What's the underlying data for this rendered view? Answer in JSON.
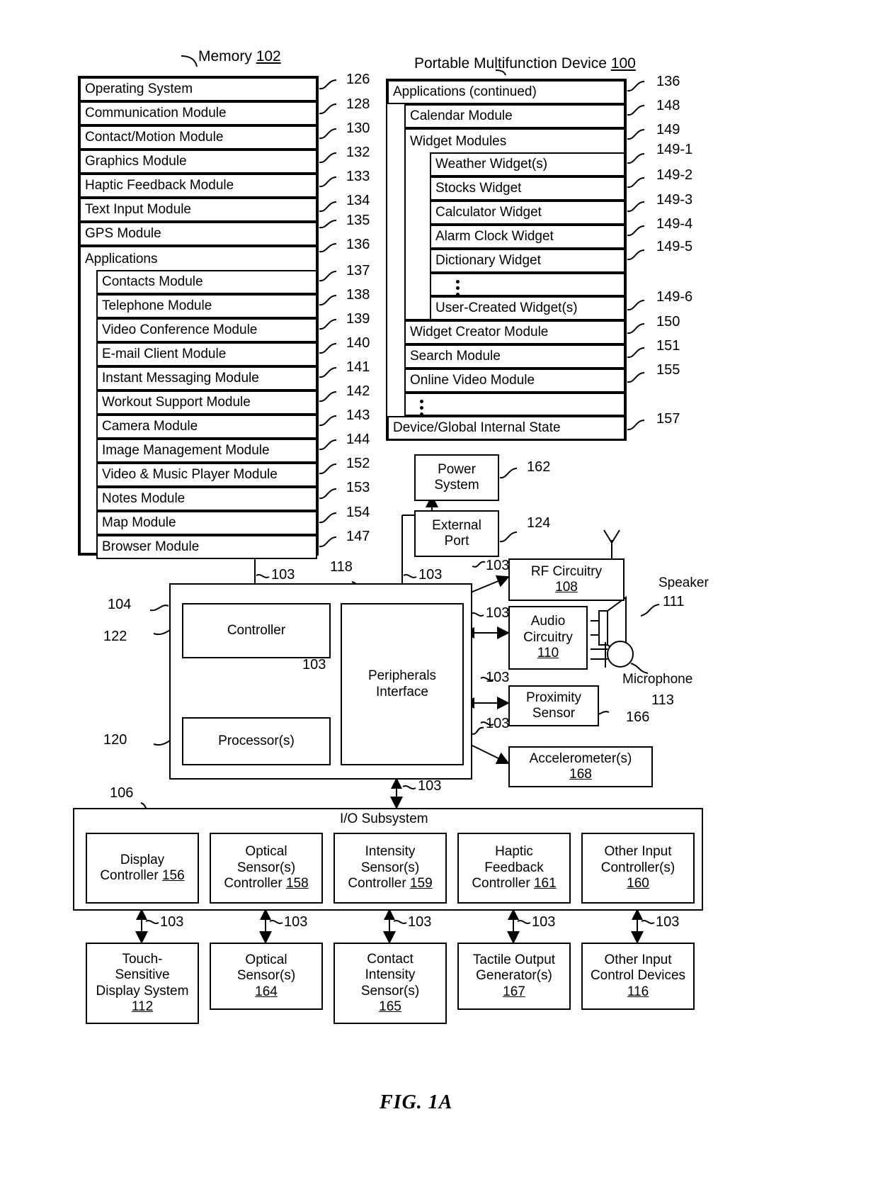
{
  "figure": {
    "caption": "FIG. 1A"
  },
  "memory": {
    "title": "Memory",
    "title_ref": "102",
    "rows": [
      {
        "label": "Operating System",
        "ref": "126"
      },
      {
        "label": "Communication Module",
        "ref": "128"
      },
      {
        "label": "Contact/Motion Module",
        "ref": "130"
      },
      {
        "label": "Graphics Module",
        "ref": "132"
      },
      {
        "label": "Haptic Feedback Module",
        "ref": "133"
      },
      {
        "label": "Text Input Module",
        "ref": "134"
      },
      {
        "label": "GPS Module",
        "ref": "135"
      },
      {
        "label": "Applications",
        "ref": "136"
      }
    ],
    "applications": [
      {
        "label": "Contacts Module",
        "ref": "137"
      },
      {
        "label": "Telephone Module",
        "ref": "138"
      },
      {
        "label": "Video Conference Module",
        "ref": "139"
      },
      {
        "label": "E-mail Client Module",
        "ref": "140"
      },
      {
        "label": "Instant Messaging Module",
        "ref": "141"
      },
      {
        "label": "Workout Support Module",
        "ref": "142"
      },
      {
        "label": "Camera Module",
        "ref": "143"
      },
      {
        "label": "Image Management Module",
        "ref": "144"
      },
      {
        "label": "Video & Music Player Module",
        "ref": "152"
      },
      {
        "label": "Notes Module",
        "ref": "153"
      },
      {
        "label": "Map Module",
        "ref": "154"
      },
      {
        "label": "Browser Module",
        "ref": "147"
      }
    ]
  },
  "device": {
    "title": "Portable Multifunction Device",
    "title_ref": "100",
    "applications_continued": {
      "label": "Applications (continued)",
      "ref": "136"
    },
    "calendar": {
      "label": "Calendar Module",
      "ref": "148"
    },
    "widget_modules": {
      "label": "Widget Modules",
      "ref": "149"
    },
    "widgets": [
      {
        "label": "Weather Widget(s)",
        "ref": "149-1"
      },
      {
        "label": "Stocks Widget",
        "ref": "149-2"
      },
      {
        "label": "Calculator Widget",
        "ref": "149-3"
      },
      {
        "label": "Alarm Clock Widget",
        "ref": "149-4"
      },
      {
        "label": "Dictionary Widget",
        "ref": "149-5"
      }
    ],
    "user_created": {
      "label": "User-Created Widget(s)",
      "ref": "149-6"
    },
    "tail_modules": [
      {
        "label": "Widget Creator Module",
        "ref": "150"
      },
      {
        "label": "Search Module",
        "ref": "151"
      },
      {
        "label": "Online Video Module",
        "ref": "155"
      }
    ],
    "global_state": {
      "label": "Device/Global Internal State",
      "ref": "157"
    }
  },
  "power_system": {
    "label_line1": "Power",
    "label_line2": "System",
    "ref": "162"
  },
  "external_port": {
    "label_line1": "External",
    "label_line2": "Port",
    "ref": "124"
  },
  "core": {
    "ref_104": "104",
    "controller": {
      "label": "Controller",
      "ref": "122"
    },
    "processors": {
      "label": "Processor(s)",
      "ref": "120"
    },
    "peripherals": {
      "label_line1": "Peripherals",
      "label_line2": "Interface",
      "ref": "118"
    },
    "bus_ref": "103"
  },
  "peripherals_blocks": {
    "rf": {
      "label": "RF Circuitry",
      "ref": "108"
    },
    "audio": {
      "label_line1": "Audio",
      "label_line2": "Circuitry",
      "ref": "110"
    },
    "proximity": {
      "label_line1": "Proximity",
      "label_line2": "Sensor",
      "ref": "166"
    },
    "accelerometer": {
      "label": "Accelerometer(s)",
      "ref": "168"
    },
    "speaker": {
      "label": "Speaker",
      "ref": "111"
    },
    "microphone": {
      "label": "Microphone",
      "ref": "113"
    }
  },
  "io_subsystem": {
    "title": "I/O Subsystem",
    "ref": "106",
    "bus_ref": "103",
    "controllers": [
      {
        "lines": [
          "Display",
          "Controller"
        ],
        "ref": "156"
      },
      {
        "lines": [
          "Optical",
          "Sensor(s)",
          "Controller"
        ],
        "ref": "158"
      },
      {
        "lines": [
          "Intensity",
          "Sensor(s)",
          "Controller"
        ],
        "ref": "159"
      },
      {
        "lines": [
          "Haptic",
          "Feedback",
          "Controller"
        ],
        "ref": "161"
      },
      {
        "lines": [
          "Other Input",
          "Controller(s)"
        ],
        "ref": "160"
      }
    ],
    "devices": [
      {
        "lines": [
          "Touch-",
          "Sensitive",
          "Display System"
        ],
        "ref": "112"
      },
      {
        "lines": [
          "Optical",
          "Sensor(s)"
        ],
        "ref": "164"
      },
      {
        "lines": [
          "Contact",
          "Intensity",
          "Sensor(s)"
        ],
        "ref": "165"
      },
      {
        "lines": [
          "Tactile Output",
          "Generator(s)"
        ],
        "ref": "167"
      },
      {
        "lines": [
          "Other Input",
          "Control Devices"
        ],
        "ref": "116"
      }
    ]
  }
}
